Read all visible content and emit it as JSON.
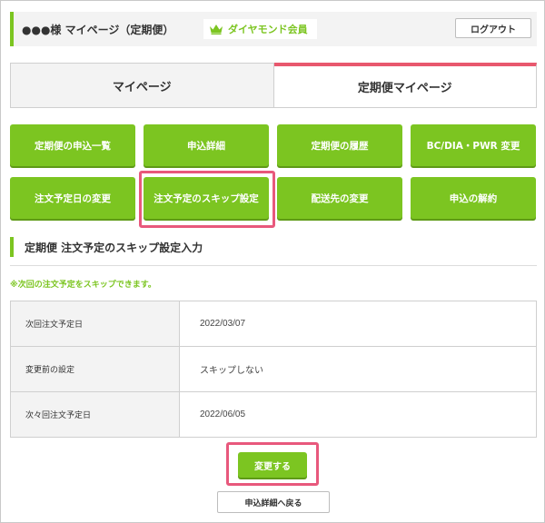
{
  "header": {
    "greeting": "●●●様 マイページ（定期便）",
    "member_badge": "ダイヤモンド会員",
    "logout_label": "ログアウト"
  },
  "tabs": [
    {
      "label": "マイページ",
      "active": false
    },
    {
      "label": "定期便マイページ",
      "active": true
    }
  ],
  "menu": [
    {
      "label": "定期便の申込一覧"
    },
    {
      "label": "申込詳細"
    },
    {
      "label": "定期便の履歴"
    },
    {
      "label": "BC/DIA・PWR 変更"
    },
    {
      "label": "注文予定日の変更"
    },
    {
      "label": "注文予定のスキップ設定",
      "highlighted": true
    },
    {
      "label": "配送先の変更"
    },
    {
      "label": "申込の解約"
    }
  ],
  "section": {
    "title": "定期便 注文予定のスキップ設定入力",
    "notice": "※次回の注文予定をスキップできます。"
  },
  "table": {
    "rows": [
      {
        "label": "次回注文予定日",
        "value": "2022/03/07"
      },
      {
        "label": "変更前の設定",
        "value": "スキップしない"
      },
      {
        "label": "次々回注文予定日",
        "value": "2022/06/05"
      }
    ]
  },
  "actions": {
    "submit_label": "変更する",
    "back_label": "申込詳細へ戻る"
  },
  "colors": {
    "accent_green": "#7cc521",
    "tab_accent_pink": "#e8586e",
    "highlight_pink": "#e8587c"
  }
}
